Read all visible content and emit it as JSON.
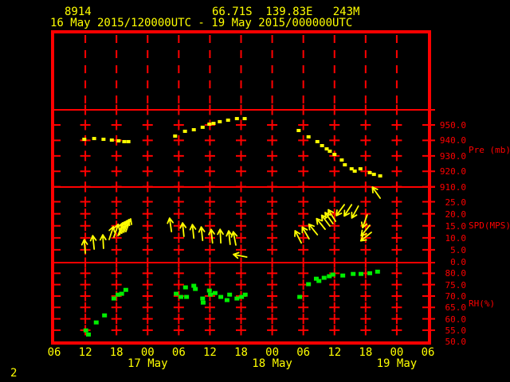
{
  "colors": {
    "background": "#000000",
    "axis_red": "#ff0000",
    "data_yellow": "#ffff00",
    "data_green": "#00ee00"
  },
  "header": {
    "station_id": "8914",
    "coordinates": "66.71S  139.83E   243M",
    "time_range": "16 May 2015/120000UTC - 19 May 2015/000000UTC"
  },
  "footer": {
    "page_number": "2"
  },
  "chart_data": {
    "type": "line",
    "subtype": "meteogram-time-series",
    "title": "16 May 2015/120000UTC - 19 May 2015/000000UTC",
    "time_origin": "16 May 2015 06UTC",
    "hours_per_tick": 6,
    "x_axis": {
      "hour_tick_labels": [
        "06",
        "12",
        "18",
        "00",
        "06",
        "12",
        "18",
        "00",
        "06",
        "12",
        "18",
        "00",
        "06"
      ],
      "date_labels": [
        {
          "label": "17 May",
          "tick_index": 3
        },
        {
          "label": "18 May",
          "tick_index": 7
        },
        {
          "label": "19 May",
          "tick_index": 11
        }
      ]
    },
    "panels": [
      {
        "id": "top-blank",
        "unit_label": "",
        "tick_labels": []
      },
      {
        "id": "pressure",
        "unit_label": "Pre (mb)",
        "tick_labels": [
          "950.0",
          "940.0",
          "930.0",
          "920.0",
          "910.0"
        ],
        "ylim": [
          960,
          905
        ]
      },
      {
        "id": "wind-speed",
        "unit_label": "SPD(MPS)",
        "tick_labels": [
          "25.0",
          "20.0",
          "15.0",
          "10.0",
          "5.0",
          "0.0"
        ],
        "ylim": [
          31,
          0
        ]
      },
      {
        "id": "relative-humidity",
        "unit_label": "RH(%)",
        "tick_labels": [
          "80.0",
          "75.0",
          "70.0",
          "65.0",
          "60.0",
          "55.0",
          "50.0"
        ],
        "ylim": [
          84.5,
          50
        ]
      }
    ],
    "series": {
      "pressure_mb": {
        "color": "data_yellow",
        "points_t_hours_value": [
          [
            5.8,
            940.7
          ],
          [
            7.7,
            941.2
          ],
          [
            9.5,
            940.7
          ],
          [
            11.1,
            940.2
          ],
          [
            12.4,
            939.7
          ],
          [
            13.5,
            939.2
          ],
          [
            14.3,
            939.2
          ],
          [
            23.3,
            942.8
          ],
          [
            25.2,
            945.9
          ],
          [
            26.9,
            946.9
          ],
          [
            28.6,
            948.5
          ],
          [
            29.9,
            950.5
          ],
          [
            30.7,
            951.0
          ],
          [
            31.9,
            952.1
          ],
          [
            33.5,
            953.1
          ],
          [
            35.2,
            954.1
          ],
          [
            36.7,
            954.1
          ],
          [
            47.1,
            946.4
          ],
          [
            49.0,
            942.3
          ],
          [
            50.7,
            939.2
          ],
          [
            51.6,
            936.6
          ],
          [
            52.5,
            934.5
          ],
          [
            53.1,
            933.0
          ],
          [
            54.0,
            930.9
          ],
          [
            55.4,
            927.3
          ],
          [
            56.0,
            924.2
          ],
          [
            57.3,
            921.6
          ],
          [
            57.9,
            920.1
          ],
          [
            59.0,
            921.6
          ],
          [
            60.8,
            919.1
          ],
          [
            61.6,
            918.0
          ],
          [
            62.8,
            917.0
          ]
        ]
      },
      "wind": {
        "color": "data_yellow",
        "arrows_t_speed_dirdeg": [
          [
            6.0,
            3.6,
            -5
          ],
          [
            7.7,
            5.3,
            -6
          ],
          [
            9.5,
            5.6,
            -3
          ],
          [
            10.6,
            9.3,
            18
          ],
          [
            11.5,
            10.3,
            19
          ],
          [
            12.3,
            10.9,
            20
          ],
          [
            12.6,
            11.3,
            21
          ],
          [
            13.0,
            11.9,
            23
          ],
          [
            13.4,
            12.3,
            22
          ],
          [
            13.8,
            12.6,
            21
          ],
          [
            22.6,
            12.6,
            -8
          ],
          [
            25.0,
            10.6,
            -6
          ],
          [
            26.9,
            9.9,
            -6
          ],
          [
            28.6,
            8.9,
            -6
          ],
          [
            30.5,
            7.9,
            -6
          ],
          [
            32.1,
            7.9,
            -3
          ],
          [
            33.9,
            7.3,
            -6
          ],
          [
            35.0,
            7.0,
            -11
          ],
          [
            37.1,
            2.0,
            -79
          ],
          [
            47.6,
            7.9,
            -27
          ],
          [
            49.1,
            9.6,
            -30
          ],
          [
            50.7,
            11.3,
            -39
          ],
          [
            52.2,
            13.6,
            -39
          ],
          [
            53.1,
            14.9,
            -37
          ],
          [
            53.7,
            15.9,
            -35
          ],
          [
            54.2,
            16.9,
            -32
          ],
          [
            55.9,
            23.8,
            -144
          ],
          [
            57.3,
            23.8,
            -147
          ],
          [
            58.6,
            23.2,
            -151
          ],
          [
            60.3,
            19.5,
            -160
          ],
          [
            60.8,
            15.2,
            -141
          ],
          [
            61.1,
            12.3,
            -129
          ],
          [
            62.8,
            26.5,
            -35
          ]
        ]
      },
      "rh_pct": {
        "color": "data_green",
        "points_t_hours_value": [
          [
            6.1,
            54.9
          ],
          [
            6.6,
            53.1
          ],
          [
            8.1,
            58.4
          ],
          [
            9.7,
            61.5
          ],
          [
            11.5,
            68.9
          ],
          [
            12.3,
            70.6
          ],
          [
            13.0,
            71.0
          ],
          [
            13.8,
            72.7
          ],
          [
            23.5,
            71.0
          ],
          [
            24.4,
            69.6
          ],
          [
            25.3,
            73.8
          ],
          [
            25.5,
            69.6
          ],
          [
            26.9,
            74.5
          ],
          [
            27.2,
            73.1
          ],
          [
            28.6,
            68.9
          ],
          [
            28.7,
            67.1
          ],
          [
            29.9,
            72.4
          ],
          [
            30.1,
            70.6
          ],
          [
            31.0,
            71.3
          ],
          [
            32.1,
            69.6
          ],
          [
            33.3,
            68.2
          ],
          [
            33.8,
            70.6
          ],
          [
            35.2,
            68.9
          ],
          [
            36.1,
            69.6
          ],
          [
            36.8,
            70.6
          ],
          [
            47.3,
            69.6
          ],
          [
            49.0,
            75.2
          ],
          [
            50.5,
            77.6
          ],
          [
            51.0,
            76.6
          ],
          [
            52.0,
            78.0
          ],
          [
            53.0,
            78.7
          ],
          [
            53.7,
            79.4
          ],
          [
            55.6,
            79.0
          ],
          [
            57.6,
            79.7
          ],
          [
            59.1,
            79.7
          ],
          [
            60.8,
            80.0
          ],
          [
            62.3,
            80.7
          ]
        ]
      }
    }
  }
}
